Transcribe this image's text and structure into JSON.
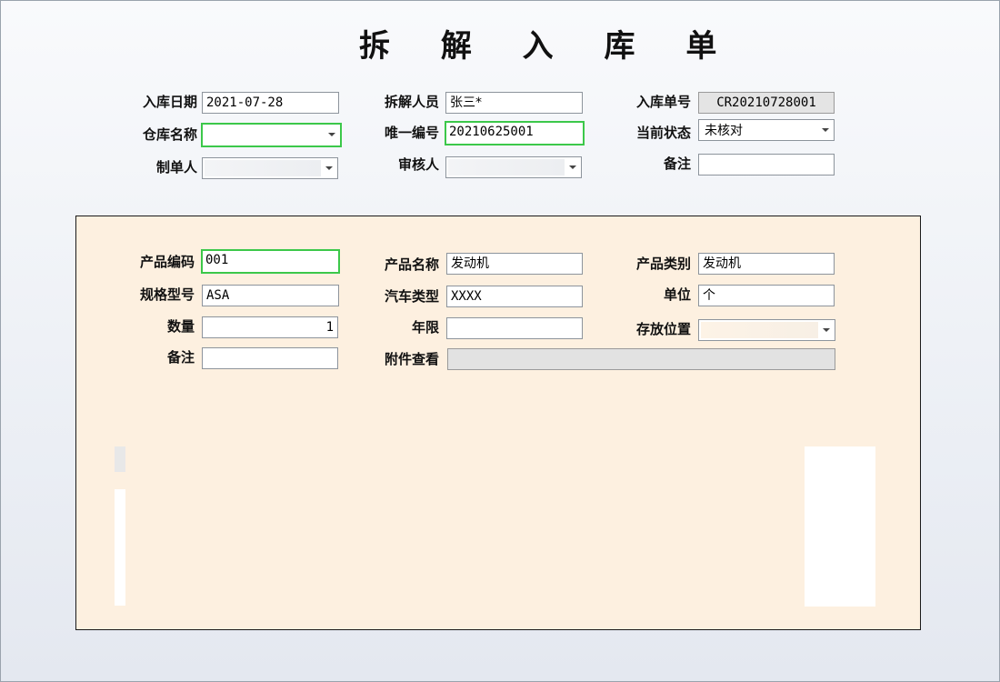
{
  "title": "拆 解 入 库 单",
  "header": {
    "inbound_date_label": "入库日期",
    "inbound_date_value": "2021-07-28",
    "dismantler_label": "拆解人员",
    "dismantler_value": "张三*",
    "inbound_no_label": "入库单号",
    "inbound_no_value": "CR20210728001",
    "warehouse_label": "仓库名称",
    "warehouse_value": "",
    "unique_no_label": "唯一编号",
    "unique_no_value": "20210625001",
    "status_label": "当前状态",
    "status_value": "未核对",
    "creator_label": "制单人",
    "creator_value": "",
    "reviewer_label": "审核人",
    "reviewer_value": "",
    "remark_label": "备注",
    "remark_value": ""
  },
  "product": {
    "code_label": "产品编码",
    "code_value": "001",
    "name_label": "产品名称",
    "name_value": "发动机",
    "category_label": "产品类别",
    "category_value": "发动机",
    "spec_label": "规格型号",
    "spec_value": "ASA",
    "car_type_label": "汽车类型",
    "car_type_value": "XXXX",
    "unit_label": "单位",
    "unit_value": "个",
    "qty_label": "数量",
    "qty_value": "1",
    "years_label": "年限",
    "years_value": "",
    "location_label": "存放位置",
    "location_value": "",
    "remark_label": "备注",
    "remark_value": "",
    "attachment_label": "附件查看",
    "attachment_value": ""
  }
}
